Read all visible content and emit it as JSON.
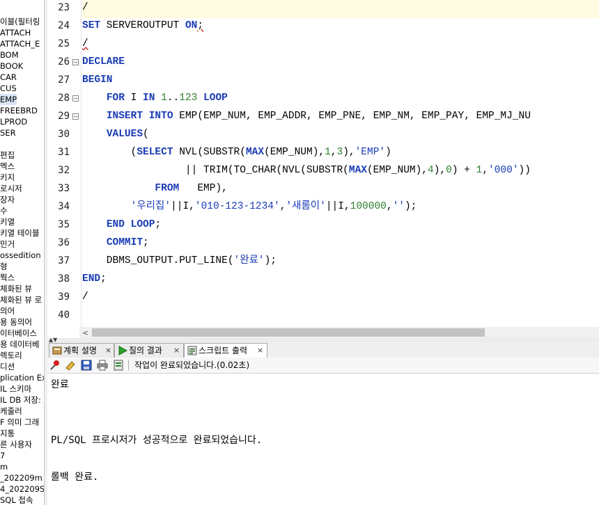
{
  "tree": {
    "items": [
      "이블(필터링",
      "ATTACH",
      "ATTACH_E",
      "BOM",
      "BOOK",
      "CAR",
      "CUS",
      "EMP",
      "FREEBRD",
      "LPROD",
      "SER",
      "",
      "편집",
      "멕스",
      "키지",
      "로시저",
      "장자",
      "수",
      "키열",
      "키열 테이블",
      "민거",
      "ossedition .",
      "형",
      "뭑스",
      "체화된 뷰",
      "체화된 뷰 로",
      "의어",
      "용 동의어",
      "이터베이스",
      "용 데이터베",
      "렉토리",
      "디션",
      "plication Ex",
      "IL 스키마",
      "IL DB 저장:",
      "케줄러",
      "F 의미 그래",
      "지통",
      "른 사용자",
      "7",
      "m",
      "_202209m",
      "4_202209S",
      "SQL 접속"
    ]
  },
  "editor": {
    "lines": [
      {
        "num": "23",
        "fold": false,
        "current": true,
        "tokens": [
          {
            "t": "/",
            "c": ""
          }
        ]
      },
      {
        "num": "24",
        "fold": false,
        "current": false,
        "tokens": [
          {
            "t": "SET",
            "c": "kw"
          },
          {
            "t": " SERVEROUTPUT ",
            "c": ""
          },
          {
            "t": "ON",
            "c": "kw"
          },
          {
            "t": ";",
            "c": "squig"
          }
        ]
      },
      {
        "num": "25",
        "fold": false,
        "current": false,
        "tokens": [
          {
            "t": "/",
            "c": "squig"
          }
        ]
      },
      {
        "num": "26",
        "fold": true,
        "current": false,
        "tokens": [
          {
            "t": "DECLARE",
            "c": "kw"
          }
        ]
      },
      {
        "num": "27",
        "fold": false,
        "current": false,
        "tokens": [
          {
            "t": "BEGIN",
            "c": "kw"
          }
        ]
      },
      {
        "num": "28",
        "fold": true,
        "current": false,
        "tokens": [
          {
            "t": "    ",
            "c": ""
          },
          {
            "t": "FOR",
            "c": "kw"
          },
          {
            "t": " I ",
            "c": ""
          },
          {
            "t": "IN",
            "c": "kw"
          },
          {
            "t": " ",
            "c": ""
          },
          {
            "t": "1",
            "c": "num"
          },
          {
            "t": "..",
            "c": ""
          },
          {
            "t": "123",
            "c": "num"
          },
          {
            "t": " ",
            "c": ""
          },
          {
            "t": "LOOP",
            "c": "kw"
          }
        ]
      },
      {
        "num": "29",
        "fold": true,
        "current": false,
        "tokens": [
          {
            "t": "    ",
            "c": ""
          },
          {
            "t": "INSERT",
            "c": "kw"
          },
          {
            "t": " ",
            "c": ""
          },
          {
            "t": "INTO",
            "c": "kw"
          },
          {
            "t": " EMP(EMP_NUM, EMP_ADDR, EMP_PNE, EMP_NM, EMP_PAY, EMP_MJ_NU",
            "c": ""
          }
        ]
      },
      {
        "num": "30",
        "fold": false,
        "current": false,
        "tokens": [
          {
            "t": "    ",
            "c": ""
          },
          {
            "t": "VALUES",
            "c": "kw"
          },
          {
            "t": "(",
            "c": ""
          }
        ]
      },
      {
        "num": "31",
        "fold": false,
        "current": false,
        "tokens": [
          {
            "t": "        (",
            "c": ""
          },
          {
            "t": "SELECT",
            "c": "kw"
          },
          {
            "t": " NVL(SUBSTR(",
            "c": ""
          },
          {
            "t": "MAX",
            "c": "kw"
          },
          {
            "t": "(EMP_NUM),",
            "c": ""
          },
          {
            "t": "1",
            "c": "num"
          },
          {
            "t": ",",
            "c": ""
          },
          {
            "t": "3",
            "c": "num"
          },
          {
            "t": "),",
            "c": ""
          },
          {
            "t": "'EMP'",
            "c": "str"
          },
          {
            "t": ")",
            "c": ""
          }
        ]
      },
      {
        "num": "32",
        "fold": false,
        "current": false,
        "tokens": [
          {
            "t": "                 || TRIM(TO_CHAR(NVL(SUBSTR(",
            "c": ""
          },
          {
            "t": "MAX",
            "c": "kw"
          },
          {
            "t": "(EMP_NUM),",
            "c": ""
          },
          {
            "t": "4",
            "c": "num"
          },
          {
            "t": "),",
            "c": ""
          },
          {
            "t": "0",
            "c": "num"
          },
          {
            "t": ") + ",
            "c": ""
          },
          {
            "t": "1",
            "c": "num"
          },
          {
            "t": ",",
            "c": ""
          },
          {
            "t": "'000'",
            "c": "str"
          },
          {
            "t": "))",
            "c": ""
          }
        ]
      },
      {
        "num": "33",
        "fold": false,
        "current": false,
        "tokens": [
          {
            "t": "            ",
            "c": ""
          },
          {
            "t": "FROM",
            "c": "kw"
          },
          {
            "t": "   EMP),",
            "c": ""
          }
        ]
      },
      {
        "num": "34",
        "fold": false,
        "current": false,
        "tokens": [
          {
            "t": "        ",
            "c": ""
          },
          {
            "t": "'우리집'",
            "c": "str"
          },
          {
            "t": "||I,",
            "c": ""
          },
          {
            "t": "'010-123-1234'",
            "c": "str"
          },
          {
            "t": ",",
            "c": ""
          },
          {
            "t": "'새롬이'",
            "c": "str"
          },
          {
            "t": "||I,",
            "c": ""
          },
          {
            "t": "100000",
            "c": "num"
          },
          {
            "t": ",",
            "c": ""
          },
          {
            "t": "''",
            "c": "str"
          },
          {
            "t": ");",
            "c": ""
          }
        ]
      },
      {
        "num": "35",
        "fold": false,
        "current": false,
        "tokens": [
          {
            "t": "    ",
            "c": ""
          },
          {
            "t": "END",
            "c": "kw"
          },
          {
            "t": " ",
            "c": ""
          },
          {
            "t": "LOOP",
            "c": "kw"
          },
          {
            "t": ";",
            "c": ""
          }
        ]
      },
      {
        "num": "36",
        "fold": false,
        "current": false,
        "tokens": [
          {
            "t": "    ",
            "c": ""
          },
          {
            "t": "COMMIT",
            "c": "kw"
          },
          {
            "t": ";",
            "c": ""
          }
        ]
      },
      {
        "num": "37",
        "fold": false,
        "current": false,
        "tokens": [
          {
            "t": "    DBMS_OUTPUT.PUT_LINE(",
            "c": ""
          },
          {
            "t": "'완료'",
            "c": "str"
          },
          {
            "t": ");",
            "c": ""
          }
        ]
      },
      {
        "num": "38",
        "fold": false,
        "current": false,
        "tokens": [
          {
            "t": "END",
            "c": "kw"
          },
          {
            "t": ";",
            "c": ""
          }
        ]
      },
      {
        "num": "39",
        "fold": false,
        "current": false,
        "tokens": [
          {
            "t": "/",
            "c": ""
          }
        ]
      },
      {
        "num": "40",
        "fold": false,
        "current": false,
        "tokens": []
      }
    ]
  },
  "tabs": [
    {
      "label": "계획 설명",
      "close": "×",
      "icon": "explain-plan-icon",
      "active": false
    },
    {
      "label": "질의 결과",
      "close": "×",
      "icon": "run-icon",
      "active": false
    },
    {
      "label": "스크립트 출력",
      "close": "×",
      "icon": "script-output-icon",
      "active": true
    }
  ],
  "toolbar": {
    "status": "작업이 완료되었습니다.(0.02초)",
    "icons": [
      "pin-icon",
      "eraser-icon",
      "save-icon",
      "print-icon",
      "export-icon"
    ]
  },
  "output": {
    "lines": [
      "완료",
      "",
      "",
      "PL/SQL 프로시저가 성공적으로 완료되었습니다.",
      "",
      "롤백 완료."
    ]
  },
  "colors": {
    "keyword": "#1a3bb5",
    "number": "#2f7e2f",
    "current_line": "#fffbe0",
    "selected_tree_item": "#d9e5f5"
  }
}
